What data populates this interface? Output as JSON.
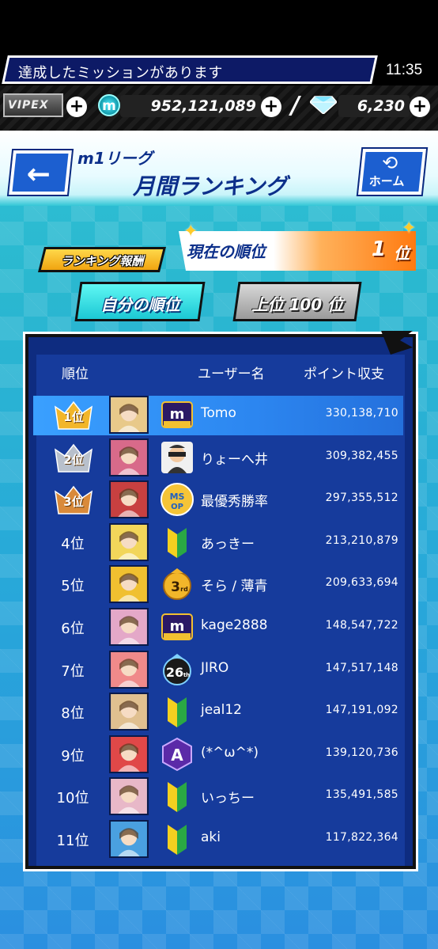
{
  "status": {
    "mission_text": "達成したミッションがあります",
    "time": "11:35"
  },
  "currency": {
    "vip_label": "VIPEX",
    "coin_symbol": "m",
    "coins": "952,121,089",
    "gems": "6,230"
  },
  "header": {
    "league": "m1リーグ",
    "title": "月間ランキング",
    "home_label": "ホーム"
  },
  "rank_bar": {
    "reward_label": "ランキング報酬",
    "current_label": "現在の順位",
    "current_rank": "1",
    "current_unit": "位"
  },
  "tabs": {
    "mine": "自分の順位",
    "top": "上位 100 位"
  },
  "table": {
    "headers": {
      "rank": "順位",
      "user": "ユーザー名",
      "points": "ポイント収支"
    },
    "rows": [
      {
        "rank": "1位",
        "name": "Tomo",
        "points": "330,138,710",
        "badge": "legend-badge",
        "avatar_color": "#e8c98a"
      },
      {
        "rank": "2位",
        "name": "りょーへ井",
        "points": "309,382,455",
        "badge": "sunglasses-avatar-badge",
        "avatar_color": "#d86a8a"
      },
      {
        "rank": "3位",
        "name": "最優秀勝率",
        "points": "297,355,512",
        "badge": "ms-op-badge",
        "avatar_color": "#c84040"
      },
      {
        "rank": "4位",
        "name": "あっきー",
        "points": "213,210,879",
        "badge": "beginner-leaf-badge",
        "avatar_color": "#f2d65a"
      },
      {
        "rank": "5位",
        "name": "そら / 薄青",
        "points": "209,633,694",
        "badge": "3rd-badge",
        "avatar_color": "#f0c030"
      },
      {
        "rank": "6位",
        "name": "kage2888",
        "points": "148,547,722",
        "badge": "legend-badge",
        "avatar_color": "#e4a8c8"
      },
      {
        "rank": "7位",
        "name": "JIRO",
        "points": "147,517,148",
        "badge": "26th-badge",
        "avatar_color": "#f08a8a"
      },
      {
        "rank": "8位",
        "name": "jeal12",
        "points": "147,191,092",
        "badge": "beginner-leaf-badge",
        "avatar_color": "#e0c090"
      },
      {
        "rank": "9位",
        "name": "(*^ω^*)",
        "points": "139,120,736",
        "badge": "a-rank-badge",
        "avatar_color": "#e04848"
      },
      {
        "rank": "10位",
        "name": "いっちー",
        "points": "135,491,585",
        "badge": "beginner-leaf-badge",
        "avatar_color": "#e8b8c8"
      },
      {
        "rank": "11位",
        "name": "aki",
        "points": "117,822,364",
        "badge": "beginner-leaf-badge",
        "avatar_color": "#4aa0e0"
      }
    ],
    "medals": [
      "1位",
      "2位",
      "3位"
    ]
  },
  "colors": {
    "accent": "#1c5fd0",
    "panel": "#163b9c",
    "highlight": "#3aa0ff",
    "title": "#0c2f8a"
  }
}
